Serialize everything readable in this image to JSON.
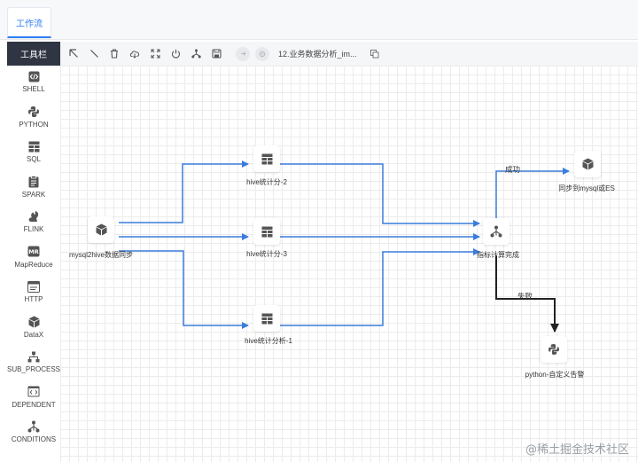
{
  "tab": {
    "label": "工作流"
  },
  "sidebar": {
    "title": "工具栏",
    "items": [
      {
        "label": "SHELL",
        "icon": "code-icon"
      },
      {
        "label": "PYTHON",
        "icon": "python-icon"
      },
      {
        "label": "SQL",
        "icon": "database-icon"
      },
      {
        "label": "SPARK",
        "icon": "clipboard-icon"
      },
      {
        "label": "FLINK",
        "icon": "squirrel-icon"
      },
      {
        "label": "MapReduce",
        "icon": "mr-icon"
      },
      {
        "label": "HTTP",
        "icon": "http-icon"
      },
      {
        "label": "DataX",
        "icon": "cube-icon"
      },
      {
        "label": "SUB_PROCESS",
        "icon": "hierarchy-icon"
      },
      {
        "label": "DEPENDENT",
        "icon": "code-window-icon"
      },
      {
        "label": "CONDITIONS",
        "icon": "branch-icon"
      }
    ]
  },
  "toolbar": {
    "workflow_name": "12.业务数据分析_im..."
  },
  "nodes": {
    "mysql2hive": {
      "label": "mysql2hive数据同步"
    },
    "hive2": {
      "label": "hive统计分-2"
    },
    "hive3": {
      "label": "hive统计分-3"
    },
    "hive1": {
      "label": "hive统计分析-1"
    },
    "cond": {
      "label": "指标计算完成"
    },
    "sync": {
      "label": "同步到mysql或ES"
    },
    "python": {
      "label": "python-自定义告警"
    }
  },
  "edges": {
    "success": "成功",
    "fail": "失败"
  },
  "watermark": "@稀土掘金技术社区",
  "colors": {
    "edge": "#3a7ddb",
    "edge_fail": "#222222",
    "sidebar_header": "#2f3542",
    "accent": "#2f7bf5"
  }
}
